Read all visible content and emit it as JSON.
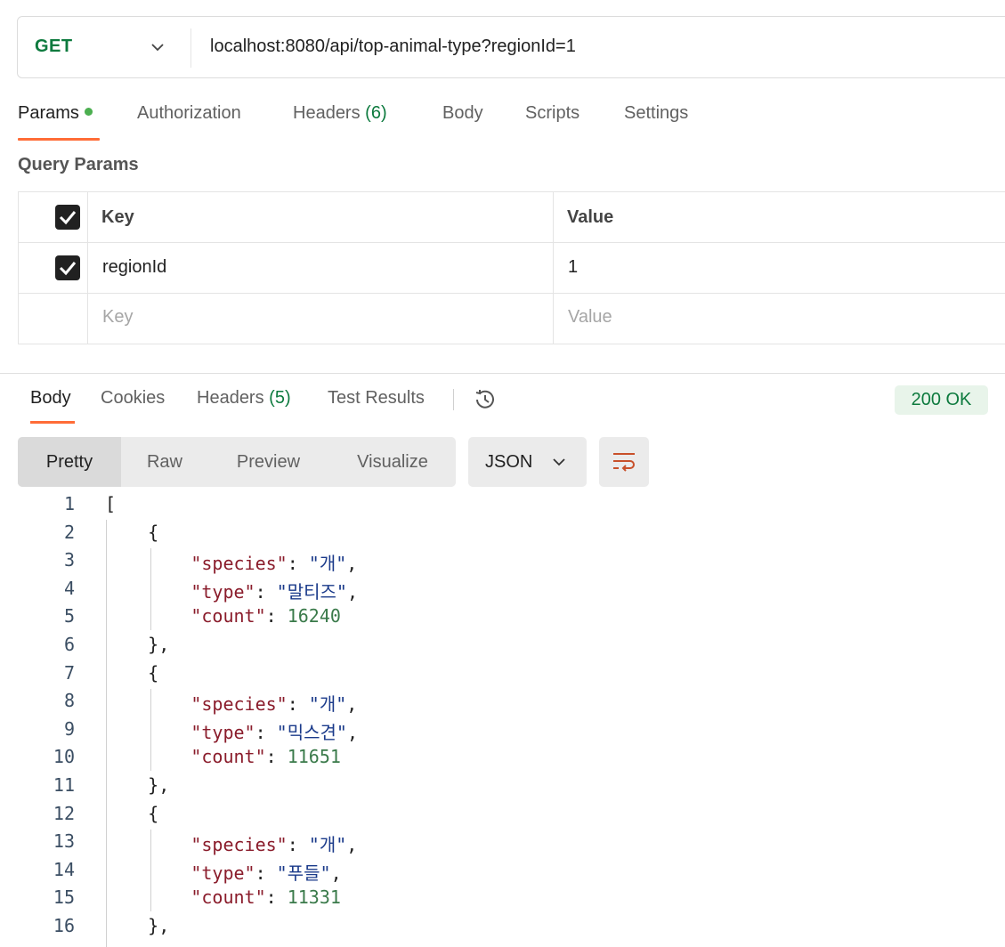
{
  "request": {
    "method": "GET",
    "url": "localhost:8080/api/top-animal-type?regionId=1"
  },
  "request_tabs": [
    {
      "label": "Params",
      "active": true,
      "has_dot": true
    },
    {
      "label": "Authorization"
    },
    {
      "label": "Headers",
      "count": "(6)"
    },
    {
      "label": "Body"
    },
    {
      "label": "Scripts"
    },
    {
      "label": "Settings"
    }
  ],
  "query_params": {
    "title": "Query Params",
    "header": {
      "key": "Key",
      "value": "Value"
    },
    "rows": [
      {
        "key": "regionId",
        "value": "1",
        "checked": true
      }
    ],
    "placeholder": {
      "key": "Key",
      "value": "Value"
    }
  },
  "response_tabs": [
    {
      "label": "Body",
      "active": true
    },
    {
      "label": "Cookies"
    },
    {
      "label": "Headers",
      "count": "(5)"
    },
    {
      "label": "Test Results"
    }
  ],
  "status": "200 OK",
  "view_modes": [
    "Pretty",
    "Raw",
    "Preview",
    "Visualize"
  ],
  "active_view": "Pretty",
  "format": "JSON",
  "code_lines": [
    {
      "n": "1",
      "text": "["
    },
    {
      "n": "2",
      "text": "    {"
    },
    {
      "n": "3",
      "text": "        \"species\": \"개\","
    },
    {
      "n": "4",
      "text": "        \"type\": \"말티즈\","
    },
    {
      "n": "5",
      "text": "        \"count\": 16240"
    },
    {
      "n": "6",
      "text": "    },"
    },
    {
      "n": "7",
      "text": "    {"
    },
    {
      "n": "8",
      "text": "        \"species\": \"개\","
    },
    {
      "n": "9",
      "text": "        \"type\": \"믹스견\","
    },
    {
      "n": "10",
      "text": "        \"count\": 11651"
    },
    {
      "n": "11",
      "text": "    },"
    },
    {
      "n": "12",
      "text": "    {"
    },
    {
      "n": "13",
      "text": "        \"species\": \"개\","
    },
    {
      "n": "14",
      "text": "        \"type\": \"푸들\","
    },
    {
      "n": "15",
      "text": "        \"count\": 11331"
    },
    {
      "n": "16",
      "text": "    },"
    }
  ],
  "colors": {
    "accent": "#ff6c37",
    "method": "#0d7a3e",
    "status_bg": "#e8f4ea"
  }
}
